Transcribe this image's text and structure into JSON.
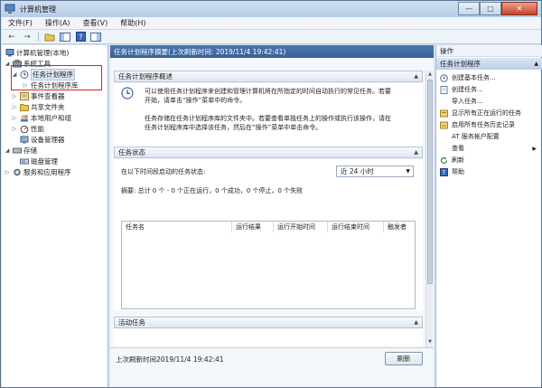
{
  "window": {
    "title": "计算机管理"
  },
  "window_controls": {
    "minimize": "—",
    "maximize": "□",
    "close": "✕"
  },
  "menu": [
    {
      "label": "文件(F)"
    },
    {
      "label": "操作(A)"
    },
    {
      "label": "查看(V)"
    },
    {
      "label": "帮助(H)"
    }
  ],
  "toolbar": {
    "back": "←",
    "forward": "→"
  },
  "tree": {
    "root": "计算机管理(本地)",
    "system_tools": "系统工具",
    "task_scheduler": "任务计划程序",
    "task_scheduler_library": "任务计划程序库",
    "event_viewer": "事件查看器",
    "shared_folders": "共享文件夹",
    "local_users": "本地用户和组",
    "performance": "性能",
    "device_manager": "设备管理器",
    "storage": "存储",
    "disk_management": "磁盘管理",
    "services": "服务和应用程序"
  },
  "main": {
    "header": "任务计划程序摘要(上次刷新时间: 2019/11/4 19:42:41)",
    "overview": {
      "title": "任务计划程序概述",
      "para1_line1": "可以使用任务计划程序来创建和管理计算机将在所指定的时间自动执行的常见任务。若要",
      "para1_line2": "开始，请单击“操作”菜单中的命令。",
      "para2_line1": "任务存储在任务计划程序库的文件夹中。若要查看单独任务上的操作或执行该操作，请在",
      "para2_line2": "任务计划程序库中选择该任务，然后在“操作”菜单中单击命令。"
    },
    "status": {
      "title": "任务状态",
      "filter_label": "在以下时间段启动的任务状态:",
      "filter_value": "近 24 小时",
      "summary": "摘要: 总计 0 个 - 0 个正在运行，0 个成功，0 个停止，0 个失败",
      "columns": [
        "任务名",
        "运行结果",
        "运行开始时间",
        "运行结束时间",
        "触发者"
      ]
    },
    "active": {
      "title": "活动任务"
    },
    "footer": {
      "last_refresh": "上次刷新时间2019/11/4 19:42:41",
      "refresh_button": "刷新"
    }
  },
  "actions": {
    "title": "操作",
    "section": "任务计划程序",
    "items": [
      {
        "label": "创建基本任务..."
      },
      {
        "label": "创建任务..."
      },
      {
        "label": "导入任务..."
      },
      {
        "label": "显示所有正在运行的任务"
      },
      {
        "label": "启用所有任务历史记录"
      },
      {
        "label": "AT 服务帐户配置"
      },
      {
        "label": "查看"
      },
      {
        "label": "刷新"
      },
      {
        "label": "帮助"
      }
    ]
  }
}
